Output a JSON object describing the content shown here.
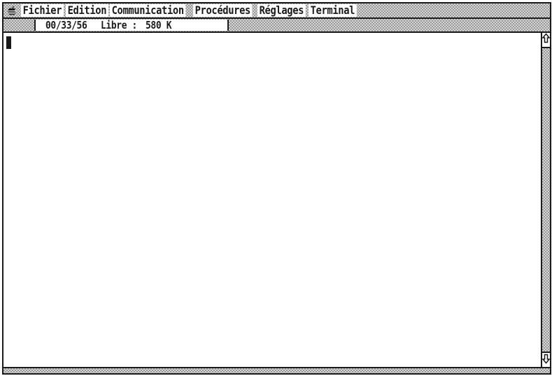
{
  "menubar": {
    "apple_icon": "apple-menu-icon",
    "items": [
      {
        "label": "Fichier"
      },
      {
        "label": "Edition"
      },
      {
        "label": "Communication"
      },
      {
        "label": "Procédures"
      },
      {
        "label": "Réglages"
      },
      {
        "label": "Terminal"
      }
    ]
  },
  "status": {
    "time": "00/33/56",
    "free_label": "Libre :",
    "free_value": "580 K"
  },
  "terminal": {
    "content": "",
    "cursor": "block-cursor"
  },
  "scrollbar": {
    "up_icon": "arrow-up-icon",
    "down_icon": "arrow-down-icon"
  },
  "colors": {
    "ink": "#1a1a1a",
    "paper": "#ffffff",
    "dither": "#d6d6d6"
  }
}
